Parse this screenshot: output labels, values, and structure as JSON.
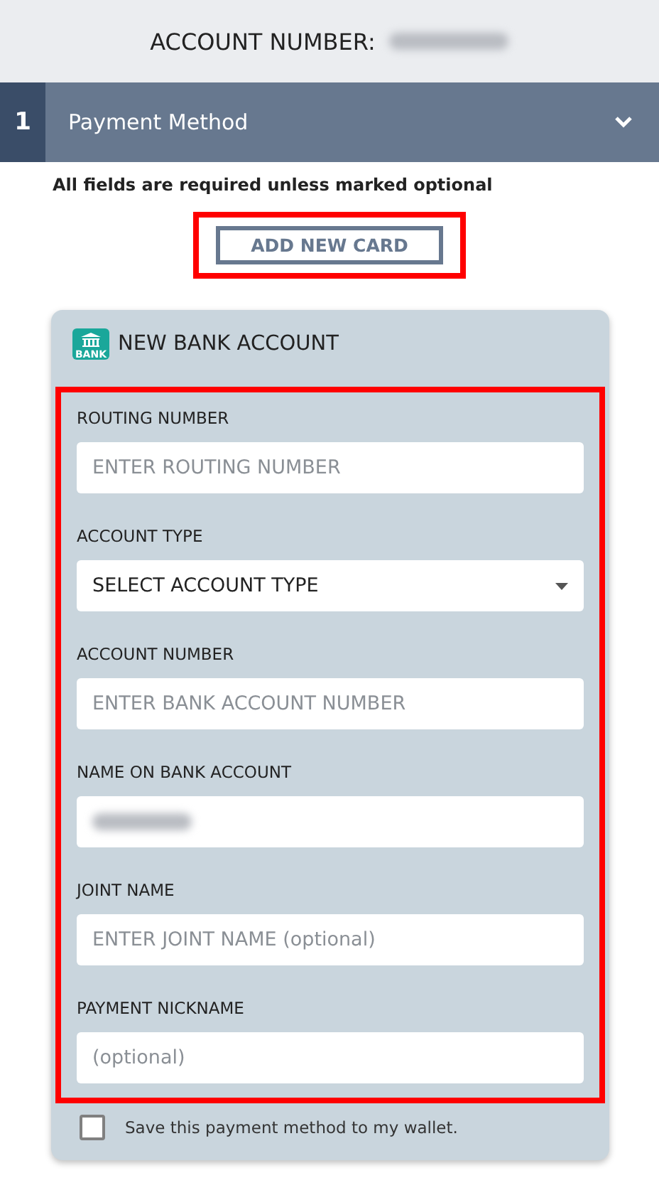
{
  "header": {
    "label": "ACCOUNT NUMBER:"
  },
  "section": {
    "number": "1",
    "title": "Payment Method",
    "expanded": true
  },
  "notice": "All fields are required unless marked optional",
  "add_card_button": {
    "label": "ADD NEW CARD",
    "highlighted": true
  },
  "card": {
    "icon_label": "BANK",
    "title": "NEW BANK ACCOUNT",
    "fields_highlighted": true,
    "fields": [
      {
        "kind": "text",
        "label": "ROUTING NUMBER",
        "placeholder": "ENTER ROUTING NUMBER"
      },
      {
        "kind": "select",
        "label": "ACCOUNT TYPE",
        "value": "SELECT ACCOUNT TYPE"
      },
      {
        "kind": "text",
        "label": "ACCOUNT NUMBER",
        "placeholder": "ENTER BANK ACCOUNT NUMBER"
      },
      {
        "kind": "redacted",
        "label": "NAME ON BANK ACCOUNT"
      },
      {
        "kind": "text",
        "label": "JOINT NAME",
        "placeholder": "ENTER JOINT NAME (optional)"
      },
      {
        "kind": "text",
        "label": "PAYMENT NICKNAME",
        "placeholder": "(optional)"
      }
    ],
    "save": {
      "label": "Save this payment method to my wallet.",
      "checked": false
    }
  }
}
